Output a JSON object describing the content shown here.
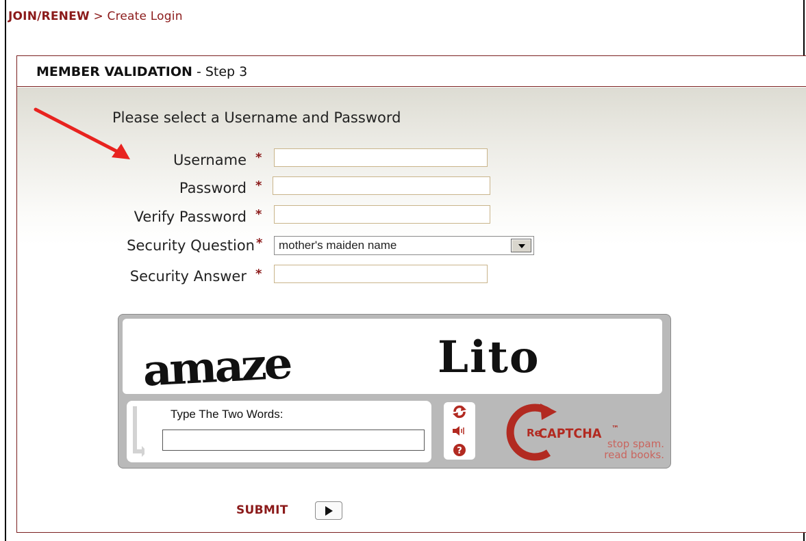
{
  "breadcrumb": {
    "parent": "JOIN/RENEW",
    "separator": ">",
    "current": "Create Login"
  },
  "panel": {
    "title_bold": "MEMBER VALIDATION",
    "title_rest": "- Step 3"
  },
  "form": {
    "instruction": "Please select a Username and Password",
    "required_marker": "*",
    "username_label": "Username",
    "username_value": "",
    "password_label": "Password",
    "password_value": "",
    "verify_label": "Verify Password",
    "verify_value": "",
    "question_label": "Security Question",
    "question_selected": "mother's maiden name",
    "answer_label": "Security Answer",
    "answer_value": ""
  },
  "captcha": {
    "words": [
      "amaze",
      "Lito"
    ],
    "hint": "Type The Two Words:",
    "response_value": "",
    "logo_re": "Re",
    "logo_name": "CAPTCHA",
    "logo_tm": "™",
    "slogan_line1": "stop spam.",
    "slogan_line2": "read books.",
    "icons": [
      "refresh-icon",
      "audio-icon",
      "help-icon"
    ]
  },
  "submit": {
    "label": "SUBMIT"
  },
  "colors": {
    "brand": "#8b1a1a",
    "annotation": "#e8231f",
    "recaptcha": "#b22a21"
  }
}
